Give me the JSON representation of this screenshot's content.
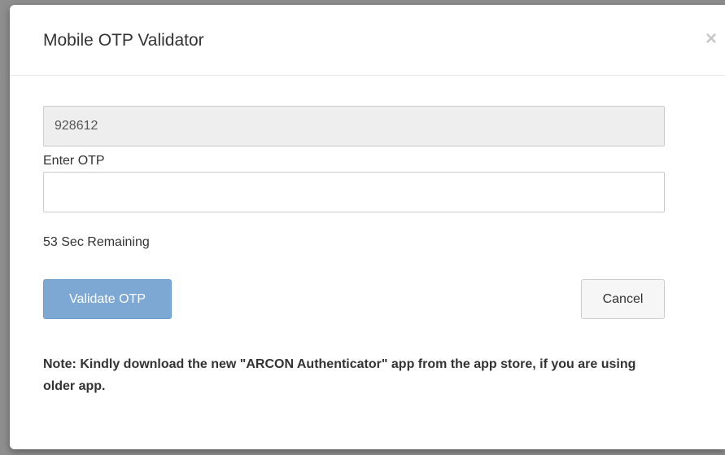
{
  "dialog": {
    "title": "Mobile OTP Validator",
    "close_glyph": "×"
  },
  "otp_display": {
    "value": "928612"
  },
  "otp_input": {
    "label": "Enter OTP",
    "value": ""
  },
  "timer": {
    "text": "53 Sec Remaining"
  },
  "buttons": {
    "validate_label": "Validate OTP",
    "cancel_label": "Cancel"
  },
  "note": {
    "text": "Note: Kindly download the new \"ARCON Authenticator\" app from the app store, if you are using older app."
  },
  "colors": {
    "primary_button": "#7ea8d4",
    "readonly_field_bg": "#eeeeee",
    "backdrop": "#8e8e8e"
  }
}
